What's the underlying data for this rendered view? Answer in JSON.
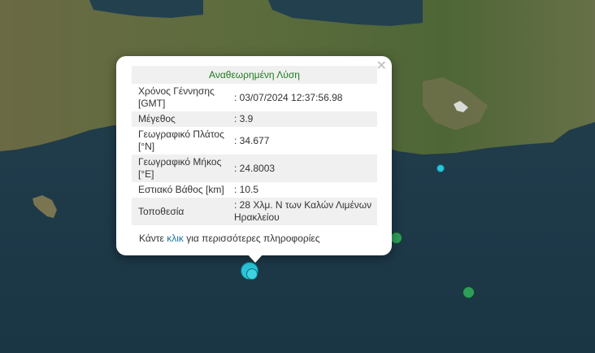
{
  "popup": {
    "header": "Αναθεωρημένη Λύση",
    "close_icon": "×",
    "rows": [
      {
        "label": "Χρόνος Γέννησης [GMT]",
        "value": ": 03/07/2024 12:37:56.98"
      },
      {
        "label": "Μέγεθος",
        "value": ": 3.9"
      },
      {
        "label": "Γεωγραφικό Πλάτος [°N]",
        "value": ": 34.677"
      },
      {
        "label": "Γεωγραφικό Μήκος [°E]",
        "value": ": 24.8003"
      },
      {
        "label": "Εστιακό Βάθος [km]",
        "value": ": 10.5"
      },
      {
        "label": "Τοποθεσία",
        "value": ": 28 Χλμ. Ν των Καλών Λιμένων Ηρακλείου"
      }
    ],
    "footer_before": "Κάντε ",
    "footer_link": "κλικ",
    "footer_after": " για περισσότερες πληροφορίες"
  },
  "colors": {
    "sea": "#1d3a4a",
    "land": "#5b6b3c",
    "marker_cyan": "#29c5d8",
    "marker_green": "#2e9e5b"
  }
}
